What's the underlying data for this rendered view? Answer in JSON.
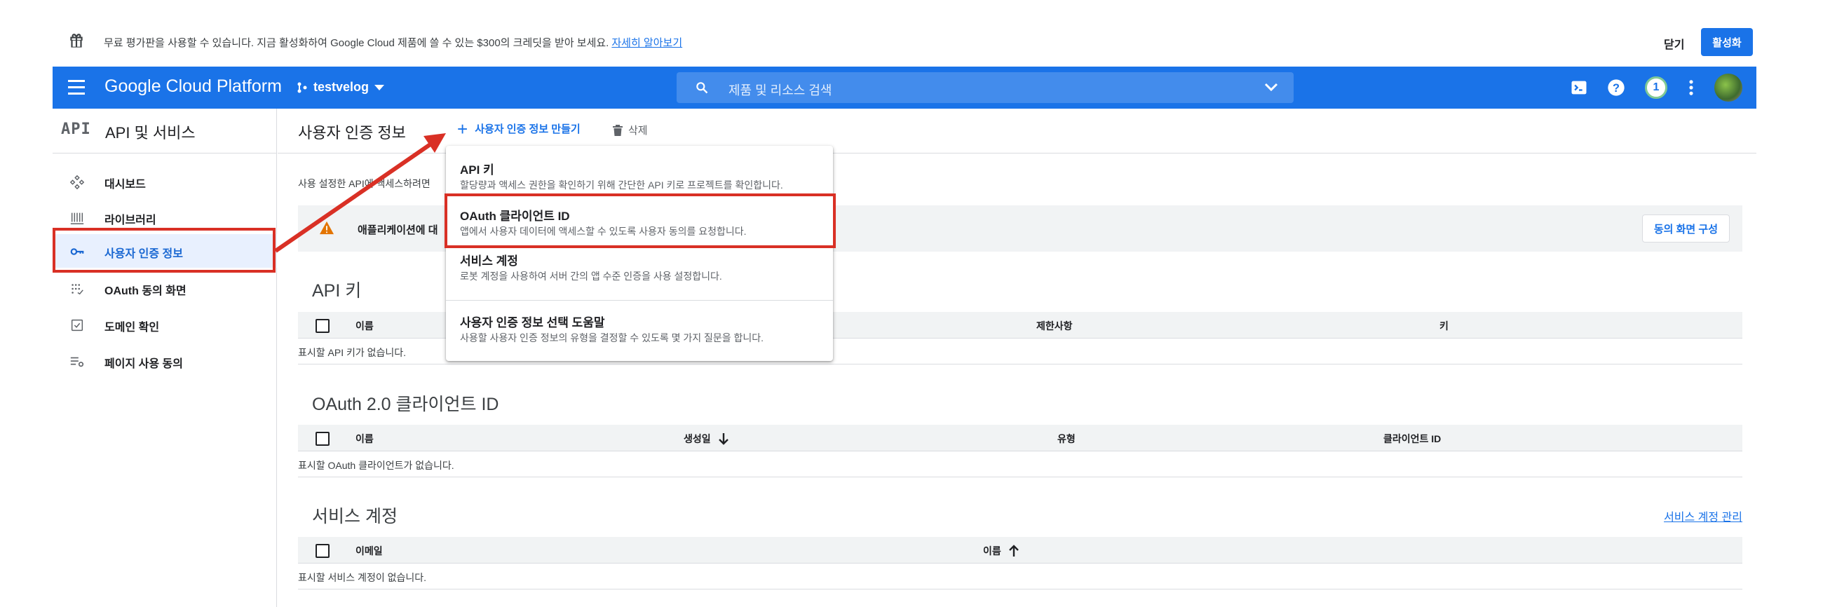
{
  "promo": {
    "message": "무료 평가판을 사용할 수 있습니다. 지금 활성화하여 Google Cloud 제품에 쓸 수 있는 $300의 크레딧을 받아 보세요.",
    "learn_more": "자세히 알아보기",
    "close": "닫기",
    "activate": "활성화"
  },
  "topbar": {
    "brand": "Google Cloud Platform",
    "project": "testvelog",
    "search_placeholder": "제품 및 리소스 검색",
    "notification_count": "1"
  },
  "sidebar": {
    "logo": "API",
    "title": "API 및 서비스",
    "items": [
      {
        "label": "대시보드",
        "icon": "dashboard-icon"
      },
      {
        "label": "라이브러리",
        "icon": "library-icon"
      },
      {
        "label": "사용자 인증 정보",
        "icon": "key-icon"
      },
      {
        "label": "OAuth 동의 화면",
        "icon": "consent-icon"
      },
      {
        "label": "도메인 확인",
        "icon": "domain-icon"
      },
      {
        "label": "페이지 사용 동의",
        "icon": "settings-list-icon"
      }
    ]
  },
  "main": {
    "title": "사용자 인증 정보",
    "create_label": "사용자 인증 정보 만들기",
    "delete_label": "삭제",
    "intro": "사용 설정한 API에 액세스하려면",
    "notice_text": "애플리케이션에 대",
    "consent_button": "동의 화면 구성",
    "api_keys": {
      "title": "API 키",
      "columns": [
        "이름",
        "제한사항",
        "키"
      ],
      "empty": "표시할 API 키가 없습니다."
    },
    "oauth": {
      "title": "OAuth 2.0 클라이언트 ID",
      "columns": [
        "이름",
        "생성일",
        "유형",
        "클라이언트 ID"
      ],
      "empty": "표시할 OAuth 클라이언트가 없습니다."
    },
    "service_accounts": {
      "title": "서비스 계정",
      "manage_link": "서비스 계정 관리",
      "columns": [
        "이메일",
        "이름"
      ],
      "empty": "표시할 서비스 계정이 없습니다."
    }
  },
  "dropdown": {
    "items": [
      {
        "title": "API 키",
        "desc": "할당량과 액세스 권한을 확인하기 위해 간단한 API 키로 프로젝트를 확인합니다."
      },
      {
        "title": "OAuth 클라이언트 ID",
        "desc": "앱에서 사용자 데이터에 액세스할 수 있도록 사용자 동의를 요청합니다."
      },
      {
        "title": "서비스 계정",
        "desc": "로봇 계정을 사용하여 서버 간의 앱 수준 인증을 사용 설정합니다."
      },
      {
        "title": "사용자 인증 정보 선택 도움말",
        "desc": "사용할 사용자 인증 정보의 유형을 결정할 수 있도록 몇 가지 질문을 합니다."
      }
    ]
  },
  "colors": {
    "primary": "#1a73e8",
    "highlight": "#d93025",
    "warning": "#e37400"
  }
}
